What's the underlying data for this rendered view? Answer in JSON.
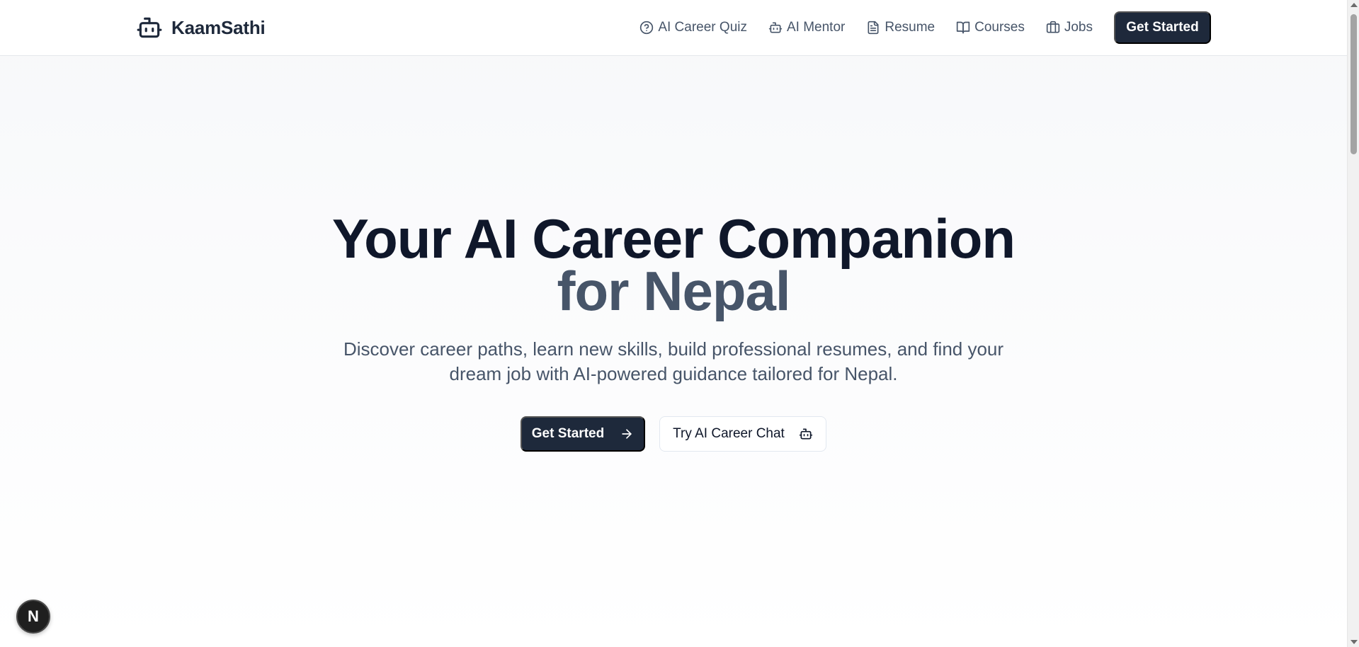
{
  "brand": {
    "name": "KaamSathi",
    "icon": "bot-icon"
  },
  "nav": {
    "items": [
      {
        "label": "AI Career Quiz",
        "icon": "help-circle-icon"
      },
      {
        "label": "AI Mentor",
        "icon": "bot-icon"
      },
      {
        "label": "Resume",
        "icon": "file-text-icon"
      },
      {
        "label": "Courses",
        "icon": "book-open-icon"
      },
      {
        "label": "Jobs",
        "icon": "briefcase-icon"
      }
    ],
    "cta_label": "Get Started"
  },
  "hero": {
    "title_line1": "Your AI Career Companion",
    "title_line2": "for Nepal",
    "subtitle": "Discover career paths, learn new skills, build professional resumes, and find your dream job with AI-powered guidance tailored for Nepal.",
    "primary_label": "Get Started",
    "primary_icon": "arrow-right-icon",
    "secondary_label": "Try AI Career Chat",
    "secondary_icon": "bot-icon"
  },
  "dev_badge": {
    "label": "N"
  },
  "colors": {
    "primary": "#1e293b",
    "heading": "#0f172a",
    "muted": "#475569",
    "border": "#e5e7eb",
    "background": "#f7f8fa"
  }
}
